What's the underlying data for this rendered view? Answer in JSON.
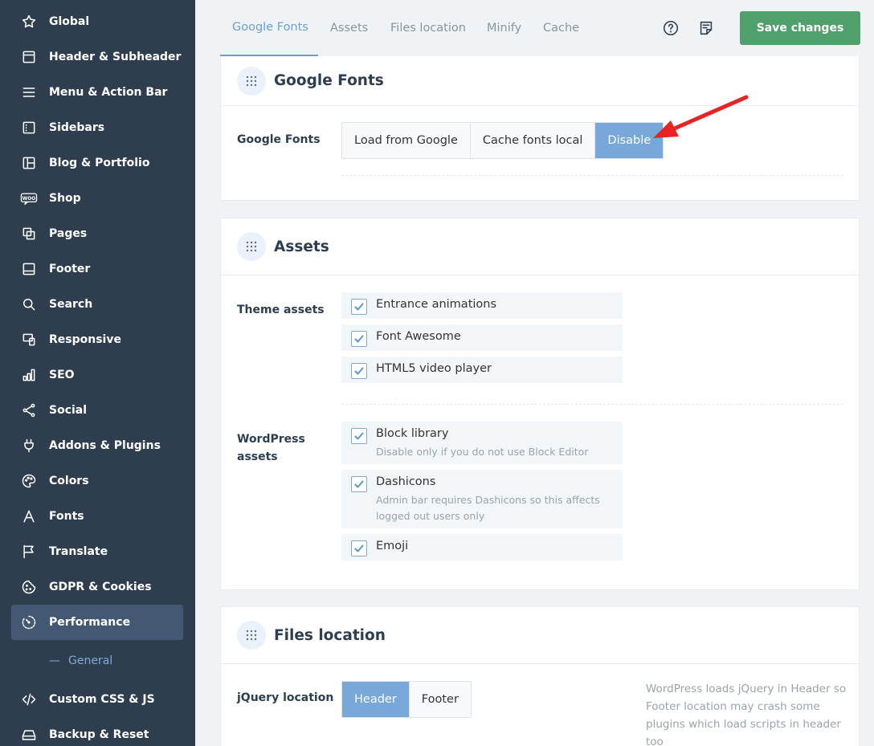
{
  "sidebar": {
    "items": [
      {
        "label": "Global",
        "icon": "star-icon"
      },
      {
        "label": "Header & Subheader",
        "icon": "header-icon"
      },
      {
        "label": "Menu & Action Bar",
        "icon": "menu-icon"
      },
      {
        "label": "Sidebars",
        "icon": "sidebar-icon"
      },
      {
        "label": "Blog & Portfolio",
        "icon": "layout-icon"
      },
      {
        "label": "Shop",
        "icon": "woo-icon"
      },
      {
        "label": "Pages",
        "icon": "pages-icon"
      },
      {
        "label": "Footer",
        "icon": "footer-icon"
      },
      {
        "label": "Search",
        "icon": "search-icon"
      },
      {
        "label": "Responsive",
        "icon": "responsive-icon"
      },
      {
        "label": "SEO",
        "icon": "bar-chart-icon"
      },
      {
        "label": "Social",
        "icon": "share-icon"
      },
      {
        "label": "Addons & Plugins",
        "icon": "plug-icon"
      },
      {
        "label": "Colors",
        "icon": "palette-icon"
      },
      {
        "label": "Fonts",
        "icon": "font-icon"
      },
      {
        "label": "Translate",
        "icon": "flag-icon"
      },
      {
        "label": "GDPR & Cookies",
        "icon": "cookie-icon"
      },
      {
        "label": "Performance",
        "icon": "gauge-icon",
        "active": true
      },
      {
        "label": "Custom CSS & JS",
        "icon": "code-icon"
      },
      {
        "label": "Backup & Reset",
        "icon": "backup-icon"
      }
    ],
    "sub_item": {
      "dash": "—",
      "label": "General"
    }
  },
  "tabs": [
    "Google Fonts",
    "Assets",
    "Files location",
    "Minify",
    "Cache"
  ],
  "toolbar": {
    "help_icon": "help-icon",
    "notes_icon": "notes-icon",
    "save_label": "Save changes"
  },
  "google_fonts": {
    "title": "Google Fonts",
    "field_label": "Google Fonts",
    "options": [
      "Load from Google",
      "Cache fonts local",
      "Disable"
    ],
    "selected": "Disable"
  },
  "assets": {
    "title": "Assets",
    "theme_label": "Theme assets",
    "theme_items": [
      {
        "label": "Entrance animations",
        "checked": true
      },
      {
        "label": "Font Awesome",
        "checked": true
      },
      {
        "label": "HTML5 video player",
        "checked": true
      }
    ],
    "wp_label_line1": "WordPress",
    "wp_label_line2": "assets",
    "wp_items": [
      {
        "label": "Block library",
        "desc": "Disable only if you do not use Block Editor",
        "checked": true
      },
      {
        "label": "Dashicons",
        "desc": "Admin bar requires Dashicons so this affects logged out users only",
        "checked": true
      },
      {
        "label": "Emoji",
        "checked": true
      }
    ]
  },
  "files_location": {
    "title": "Files location",
    "field_label": "jQuery location",
    "options": [
      "Header",
      "Footer"
    ],
    "selected": "Header",
    "note": "WordPress loads jQuery in Header so Footer location may crash some plugins which load scripts in header too"
  },
  "colors": {
    "sidebar_bg": "#2f3e4f",
    "accent": "#78a7da",
    "save_green": "#4fa06a",
    "annotation_arrow": "#e82323"
  }
}
